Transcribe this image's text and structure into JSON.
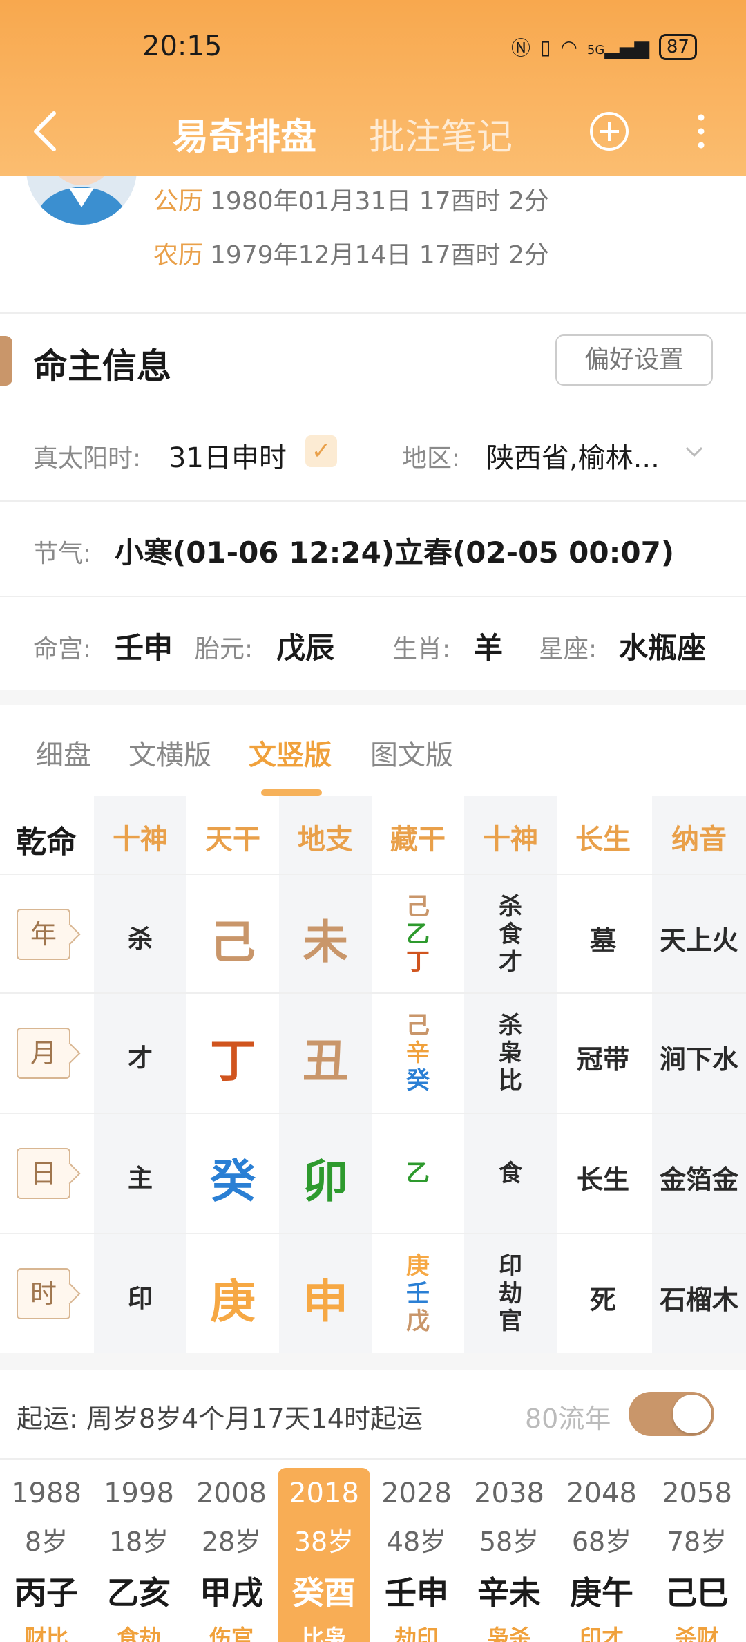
{
  "status_bar": {
    "time": "20:15",
    "battery": "87",
    "network": "5G"
  },
  "nav": {
    "title": "易奇排盘",
    "notes_tab": "批注笔记"
  },
  "profile": {
    "solar_label": "公历",
    "solar": "1980年01月31日 17酉时 2分",
    "lunar_label": "农历",
    "lunar": "1979年12月14日 17酉时 2分"
  },
  "section": {
    "title": "命主信息",
    "pref_button": "偏好设置"
  },
  "info": {
    "true_solar_label": "真太阳时:",
    "true_solar_value": "31日申时",
    "region_label": "地区:",
    "region_value": "陕西省,榆林...",
    "jieqi_label": "节气:",
    "jieqi_value": "小寒(01-06 12:24)立春(02-05 00:07)",
    "minggong_label": "命宫:",
    "minggong_value": "壬申",
    "taiyuan_label": "胎元:",
    "taiyuan_value": "戊辰",
    "shengxiao_label": "生肖:",
    "shengxiao_value": "羊",
    "xingzuo_label": "星座:",
    "xingzuo_value": "水瓶座"
  },
  "view_tabs": [
    "细盘",
    "文横版",
    "文竖版",
    "图文版"
  ],
  "view_tab_active": 2,
  "table": {
    "gender_label": "乾命",
    "headers": [
      "十神",
      "天干",
      "地支",
      "藏干",
      "十神",
      "长生",
      "纳音"
    ],
    "rows": [
      {
        "pillar": "年",
        "shishen": "杀",
        "tiangan": "己",
        "tiangan_color": "#c9966a",
        "dizhi": "未",
        "dizhi_color": "#c9966a",
        "canggan": [
          {
            "c": "己",
            "color": "#c9966a"
          },
          {
            "c": "乙",
            "color": "#2e9a2e"
          },
          {
            "c": "丁",
            "color": "#d0541e"
          }
        ],
        "shishen2": [
          "杀",
          "食",
          "才"
        ],
        "changsheng": "墓",
        "nayin": "天上火"
      },
      {
        "pillar": "月",
        "shishen": "才",
        "tiangan": "丁",
        "tiangan_color": "#d0541e",
        "dizhi": "丑",
        "dizhi_color": "#c9966a",
        "canggan": [
          {
            "c": "己",
            "color": "#c9966a"
          },
          {
            "c": "辛",
            "color": "#f0a13c"
          },
          {
            "c": "癸",
            "color": "#2a7fd4"
          }
        ],
        "shishen2": [
          "杀",
          "枭",
          "比"
        ],
        "changsheng": "冠带",
        "nayin": "涧下水"
      },
      {
        "pillar": "日",
        "shishen": "主",
        "tiangan": "癸",
        "tiangan_color": "#2a7fd4",
        "dizhi": "卯",
        "dizhi_color": "#2e9a2e",
        "canggan": [
          {
            "c": "乙",
            "color": "#2e9a2e"
          }
        ],
        "shishen2": [
          "食"
        ],
        "changsheng": "长生",
        "nayin": "金箔金"
      },
      {
        "pillar": "时",
        "shishen": "印",
        "tiangan": "庚",
        "tiangan_color": "#f6a844",
        "dizhi": "申",
        "dizhi_color": "#f6a844",
        "canggan": [
          {
            "c": "庚",
            "color": "#f6a844"
          },
          {
            "c": "壬",
            "color": "#2a7fd4"
          },
          {
            "c": "戊",
            "color": "#c9966a"
          }
        ],
        "shishen2": [
          "印",
          "劫",
          "官"
        ],
        "changsheng": "死",
        "nayin": "石榴木"
      }
    ]
  },
  "qiyun": {
    "text": "起运:  周岁8岁4个月17天14时起运",
    "liunian_label": "80流年",
    "toggle_on": true
  },
  "dayun": [
    {
      "year": "1988",
      "age": "8岁",
      "gz": "丙子",
      "ss": "财比"
    },
    {
      "year": "1998",
      "age": "18岁",
      "gz": "乙亥",
      "ss": "食劫"
    },
    {
      "year": "2008",
      "age": "28岁",
      "gz": "甲戌",
      "ss": "伤官"
    },
    {
      "year": "2018",
      "age": "38岁",
      "gz": "癸酉",
      "ss": "比枭",
      "active": true
    },
    {
      "year": "2028",
      "age": "48岁",
      "gz": "壬申",
      "ss": "劫印"
    },
    {
      "year": "2038",
      "age": "58岁",
      "gz": "辛未",
      "ss": "枭杀"
    },
    {
      "year": "2048",
      "age": "68岁",
      "gz": "庚午",
      "ss": "印才"
    },
    {
      "year": "2058",
      "age": "78岁",
      "gz": "己巳",
      "ss": "杀财"
    }
  ],
  "colors": {
    "accent": "#f0a13c",
    "header": "#f8a84e",
    "brown": "#c9966a"
  }
}
